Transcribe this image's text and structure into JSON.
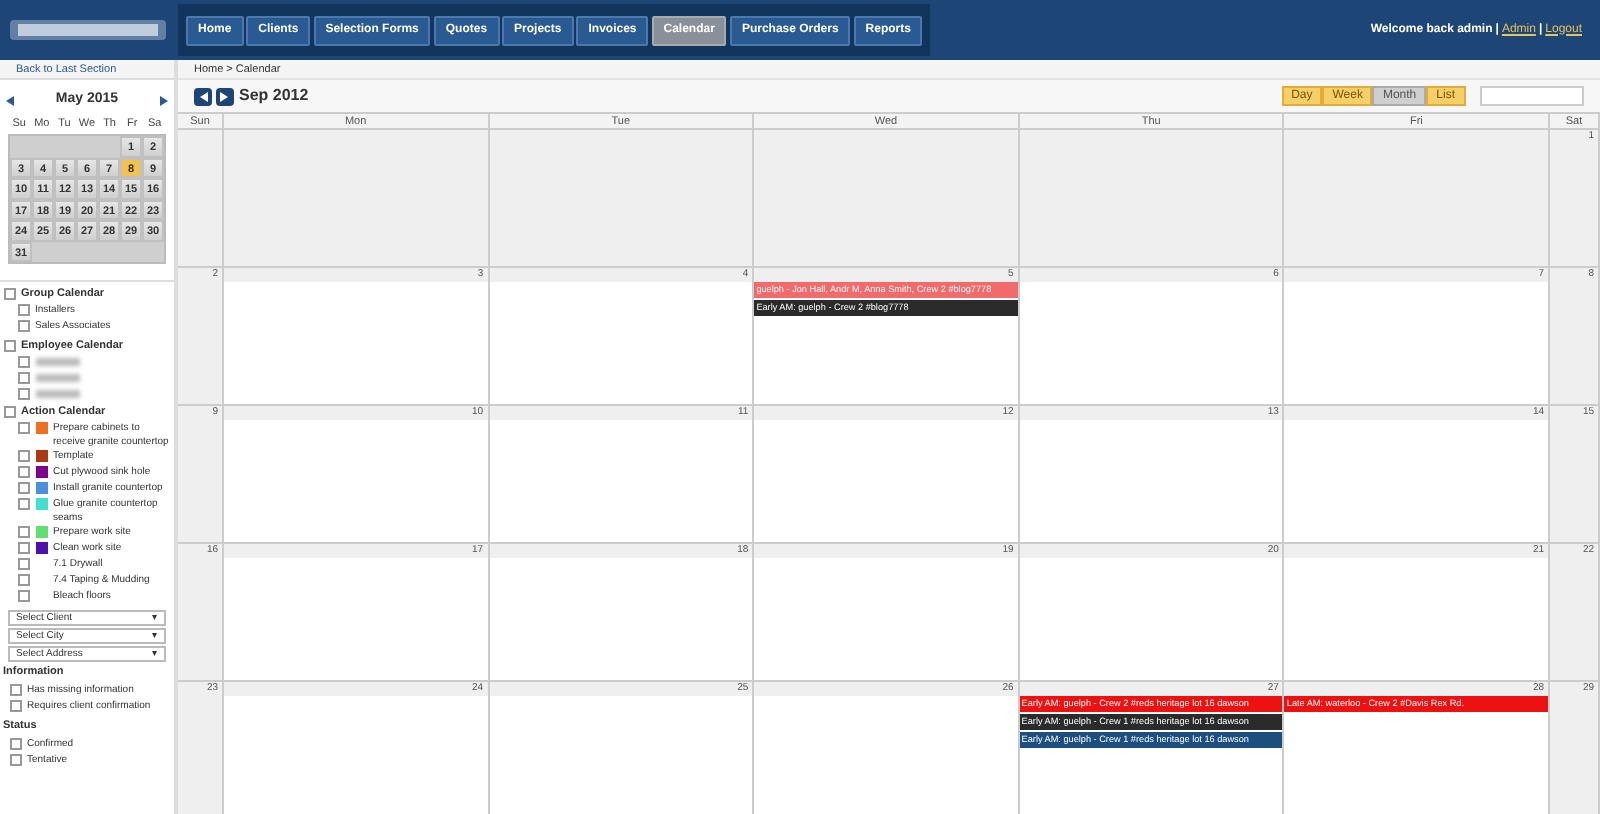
{
  "header": {
    "nav": [
      {
        "label": "Home",
        "selected": false
      },
      {
        "label": "Clients",
        "selected": false
      },
      {
        "label": "Selection Forms",
        "selected": false
      },
      {
        "label": "Quotes",
        "selected": false
      },
      {
        "label": "Projects",
        "selected": false
      },
      {
        "label": "Invoices",
        "selected": false
      },
      {
        "label": "Calendar",
        "selected": true
      },
      {
        "label": "Purchase Orders",
        "selected": false
      },
      {
        "label": "Reports",
        "selected": false
      }
    ],
    "welcome": "Welcome back admin",
    "separator": "|",
    "links": [
      "Admin",
      "Logout"
    ]
  },
  "sidebar": {
    "back_link": "Back to Last Section",
    "mini_calendar": {
      "title": "May 2015",
      "weekdays": [
        "Su",
        "Mo",
        "Tu",
        "We",
        "Th",
        "Fr",
        "Sa"
      ],
      "weeks": [
        [
          {
            "kind": "blank"
          },
          {
            "kind": "blank"
          },
          {
            "kind": "blank"
          },
          {
            "kind": "blank"
          },
          {
            "kind": "blank"
          },
          {
            "day": "1",
            "selected": false
          },
          {
            "day": "2",
            "selected": false
          }
        ],
        [
          {
            "day": "3",
            "selected": false
          },
          {
            "day": "4",
            "selected": false
          },
          {
            "day": "5",
            "selected": false
          },
          {
            "day": "6",
            "selected": false
          },
          {
            "day": "7",
            "selected": false
          },
          {
            "day": "8",
            "selected": true
          },
          {
            "day": "9",
            "selected": false
          }
        ],
        [
          {
            "day": "10",
            "selected": false
          },
          {
            "day": "11",
            "selected": false
          },
          {
            "day": "12",
            "selected": false
          },
          {
            "day": "13",
            "selected": false
          },
          {
            "day": "14",
            "selected": false
          },
          {
            "day": "15",
            "selected": false
          },
          {
            "day": "16",
            "selected": false
          }
        ],
        [
          {
            "day": "17",
            "selected": false
          },
          {
            "day": "18",
            "selected": false
          },
          {
            "day": "19",
            "selected": false
          },
          {
            "day": "20",
            "selected": false
          },
          {
            "day": "21",
            "selected": false
          },
          {
            "day": "22",
            "selected": false
          },
          {
            "day": "23",
            "selected": false
          }
        ],
        [
          {
            "day": "24",
            "selected": false
          },
          {
            "day": "25",
            "selected": false
          },
          {
            "day": "26",
            "selected": false
          },
          {
            "day": "27",
            "selected": false
          },
          {
            "day": "28",
            "selected": false
          },
          {
            "day": "29",
            "selected": false
          },
          {
            "day": "30",
            "selected": false
          }
        ],
        [
          {
            "day": "31",
            "selected": false
          },
          {
            "kind": "blank"
          },
          {
            "kind": "blank"
          },
          {
            "kind": "blank"
          },
          {
            "kind": "blank"
          },
          {
            "kind": "blank"
          },
          {
            "kind": "blank"
          }
        ]
      ]
    },
    "groups": [
      {
        "title": "Group Calendar",
        "checked": false,
        "items": [
          {
            "label": "Installers",
            "checked": false
          },
          {
            "label": "Sales Associates",
            "checked": false
          }
        ]
      },
      {
        "title": "Employee Calendar",
        "checked": false,
        "items": [
          {
            "redacted": true,
            "checked": false
          },
          {
            "redacted": true,
            "checked": false
          },
          {
            "redacted": true,
            "checked": false
          }
        ]
      },
      {
        "title": "Action Calendar",
        "checked": false,
        "items": [
          {
            "label": "Prepare cabinets to receive granite countertop",
            "checked": false,
            "color": "#f07020"
          },
          {
            "label": "Template",
            "checked": false,
            "color": "#b03810"
          },
          {
            "label": "Cut plywood sink hole",
            "checked": false,
            "color": "#800090"
          },
          {
            "label": "Install granite countertop",
            "checked": false,
            "color": "#4a90e0"
          },
          {
            "label": "Glue granite countertop seams",
            "checked": false,
            "color": "#40e0d0"
          },
          {
            "label": "Prepare work site",
            "checked": false,
            "color": "#60e070"
          },
          {
            "label": "Clean work site",
            "checked": false,
            "color": "#5010b0"
          },
          {
            "label": "7.1 Drywall",
            "checked": false
          },
          {
            "label": "7.4 Taping & Mudding",
            "checked": false
          },
          {
            "label": "Bleach floors",
            "checked": false
          }
        ]
      }
    ],
    "selects": [
      {
        "label": "Select Client",
        "caret": "▾"
      },
      {
        "label": "Select City",
        "caret": "▾"
      },
      {
        "label": "Select Address",
        "caret": "▾"
      }
    ],
    "sections": [
      {
        "title": "Information",
        "items": [
          {
            "label": "Has missing information",
            "checked": false
          },
          {
            "label": "Requires client confirmation",
            "checked": false
          }
        ]
      },
      {
        "title": "Status",
        "items": [
          {
            "label": "Confirmed",
            "checked": false
          },
          {
            "label": "Tentative",
            "checked": false
          }
        ]
      }
    ]
  },
  "calendar": {
    "breadcrumb": [
      "Home",
      "Calendar"
    ],
    "breadcrumb_separator": ">",
    "title": "Sep 2012",
    "views": [
      {
        "label": "Day",
        "selected": false
      },
      {
        "label": "Week",
        "selected": false
      },
      {
        "label": "Month",
        "selected": true
      },
      {
        "label": "List",
        "selected": false
      }
    ],
    "weekdays": [
      "Sun",
      "Mon",
      "Tue",
      "Wed",
      "Thu",
      "Fri",
      "Sat"
    ],
    "weeks": [
      [
        {
          "other_month": true
        },
        {
          "other_month": true
        },
        {
          "other_month": true
        },
        {
          "other_month": true
        },
        {
          "other_month": true
        },
        {
          "other_month": true
        },
        {
          "day": "1"
        }
      ],
      [
        {
          "day": "2"
        },
        {
          "day": "3"
        },
        {
          "day": "4"
        },
        {
          "day": "5",
          "events": [
            {
              "text": "guelph - Jon Hall, Andr M, Anna Smith, Crew 2 #blog7778",
              "color": "#f26a6a"
            },
            {
              "text": "Early AM: guelph - Crew 2 #blog7778",
              "color": "#2b2b2b"
            }
          ]
        },
        {
          "day": "6"
        },
        {
          "day": "7"
        },
        {
          "day": "8"
        }
      ],
      [
        {
          "day": "9"
        },
        {
          "day": "10"
        },
        {
          "day": "11"
        },
        {
          "day": "12"
        },
        {
          "day": "13"
        },
        {
          "day": "14"
        },
        {
          "day": "15"
        }
      ],
      [
        {
          "day": "16"
        },
        {
          "day": "17"
        },
        {
          "day": "18"
        },
        {
          "day": "19"
        },
        {
          "day": "20"
        },
        {
          "day": "21"
        },
        {
          "day": "22"
        }
      ],
      [
        {
          "day": "23"
        },
        {
          "day": "24"
        },
        {
          "day": "25"
        },
        {
          "day": "26"
        },
        {
          "day": "27",
          "events": [
            {
              "text": "Early AM: guelph - Crew 2 #reds heritage lot 16 dawson",
              "color": "#ee1111"
            },
            {
              "text": "Early AM: guelph - Crew 1 #reds heritage lot 16 dawson",
              "color": "#2b2b2b"
            },
            {
              "text": "Early AM: guelph - Crew 1 #reds heritage lot 16 dawson",
              "color": "#1c4f80"
            }
          ]
        },
        {
          "day": "28",
          "events": [
            {
              "text": "Late AM: waterloo - Crew 2 #Davis Rex Rd.",
              "color": "#ee1111"
            }
          ]
        },
        {
          "day": "29"
        }
      ]
    ]
  }
}
